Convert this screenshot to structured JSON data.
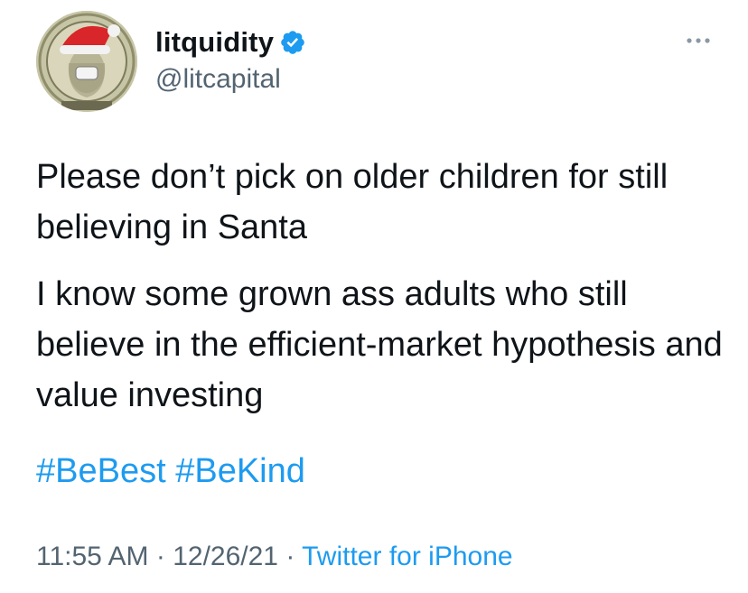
{
  "user": {
    "display_name": "litquidity",
    "handle": "@litcapital",
    "verified": true
  },
  "tweet": {
    "paragraphs": [
      "Please don’t pick on older children for still believing in Santa",
      "I know some grown ass adults who still believe in the efficient-market hypothesis and value investing"
    ],
    "hashtags": [
      "#BeBest",
      "#BeKind"
    ],
    "time": "11:55 AM",
    "date": "12/26/21",
    "separator": "·",
    "source": "Twitter for iPhone"
  },
  "icons": {
    "verified": "verified-badge-icon",
    "more": "more-options-icon",
    "avatar": "dollar-bill-santa-hat-avatar"
  },
  "colors": {
    "link": "#1d9bf0",
    "text": "#0f1419",
    "secondary": "#536471"
  }
}
